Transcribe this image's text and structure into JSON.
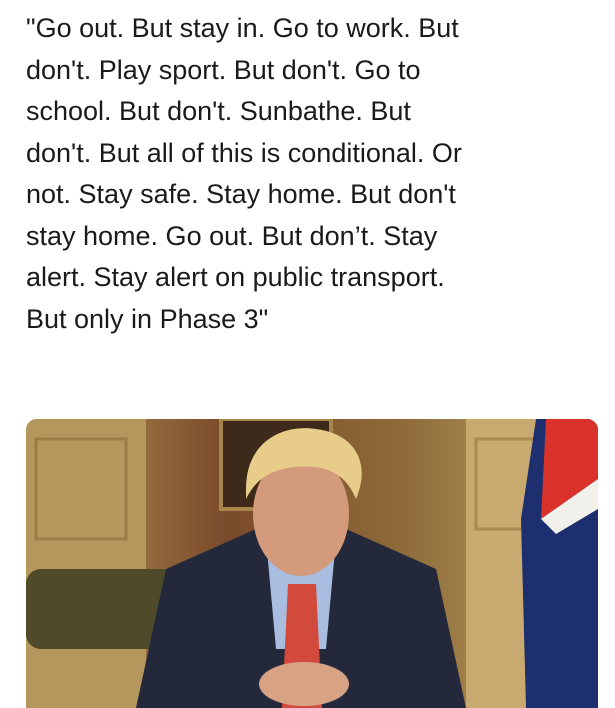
{
  "quote": {
    "lines": [
      "\"Go out. But stay in. Go to work. But",
      "don't. Play sport. But don't. Go to",
      "school. But don't. Sunbathe. But",
      "don't. But all of this is conditional. Or",
      "not. Stay safe. Stay home. But don't",
      "stay home. Go out. But don’t. Stay",
      "alert. Stay alert on public transport.",
      "But only in Phase 3\""
    ]
  },
  "photo": {
    "colors": {
      "wall": "#9c7a45",
      "door": "#b99a62",
      "suit": "#23283a",
      "shirt": "#a9bde0",
      "tie": "#d24a3c",
      "hair": "#e8cc8a",
      "skin": "#d49a7c",
      "flag_red": "#d8322a",
      "flag_blue": "#1d2f6e"
    }
  }
}
